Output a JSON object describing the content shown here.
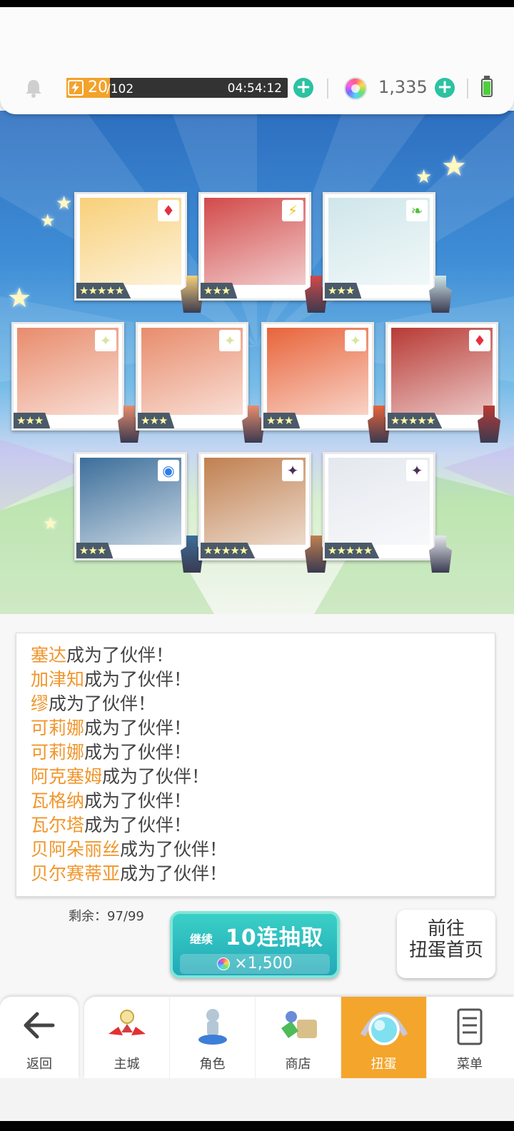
{
  "top_bar": {
    "stamina_current": "20",
    "stamina_max": "/102",
    "stamina_fraction": 0.196,
    "stamina_timer": "04:54:12",
    "gem_count": "1,335"
  },
  "cards": [
    {
      "rarity": "★★★★★",
      "element_icon": "diamond-red-icon",
      "badge": "♦",
      "badge_color": "#e33040",
      "bg": "#f8d07a"
    },
    {
      "rarity": "★★★",
      "element_icon": "lightning-icon",
      "badge": "⚡",
      "badge_color": "#f2c020",
      "bg": "#d24a4a"
    },
    {
      "rarity": "★★★",
      "element_icon": "leaf-icon",
      "badge": "❧",
      "badge_color": "#4fbf3a",
      "bg": "#cfe6ea"
    },
    {
      "rarity": "★★★",
      "element_icon": "sparkle-icon",
      "badge": "✦",
      "badge_color": "#d8e6a0",
      "bg": "#e88c6c"
    },
    {
      "rarity": "★★★",
      "element_icon": "sparkle-icon",
      "badge": "✦",
      "badge_color": "#d8e6a0",
      "bg": "#e88c6c"
    },
    {
      "rarity": "★★★",
      "element_icon": "sparkle-icon",
      "badge": "✦",
      "badge_color": "#d8e6a0",
      "bg": "#e8643a"
    },
    {
      "rarity": "★★★★★",
      "element_icon": "diamond-red-icon",
      "badge": "♦",
      "badge_color": "#e33040",
      "bg": "#b83a34"
    },
    {
      "rarity": "★★★",
      "element_icon": "circle-blue-icon",
      "badge": "◉",
      "badge_color": "#2f7de8",
      "bg": "#3c6e9a"
    },
    {
      "rarity": "★★★★★",
      "element_icon": "dark-star-icon",
      "badge": "✦",
      "badge_color": "#4a2e5a",
      "bg": "#c08050"
    },
    {
      "rarity": "★★★★★",
      "element_icon": "dark-star-icon",
      "badge": "✦",
      "badge_color": "#4a2e5a",
      "bg": "#e4e8ee"
    }
  ],
  "log": {
    "suffix": "成为了伙伴！",
    "names": [
      "塞达",
      "加津知",
      "缪",
      "可莉娜",
      "可莉娜",
      "阿克塞姆",
      "瓦格纳",
      "瓦尔塔",
      "贝阿朵丽丝",
      "贝尔赛蒂亚"
    ]
  },
  "actions": {
    "remaining": "剩余：97/99",
    "continue_label": "继续",
    "pull_label": "10连抽取",
    "pull_cost": "×1,500",
    "home_line1": "前往",
    "home_line2": "扭蛋首页"
  },
  "nav": {
    "back": "返回",
    "tabs": [
      "主城",
      "角色",
      "商店",
      "扭蛋",
      "菜单"
    ],
    "active_index": 3
  },
  "colors": {
    "accent_teal": "#2cc2a2",
    "name_orange": "#f0962c",
    "active_tab": "#f4a52c"
  }
}
